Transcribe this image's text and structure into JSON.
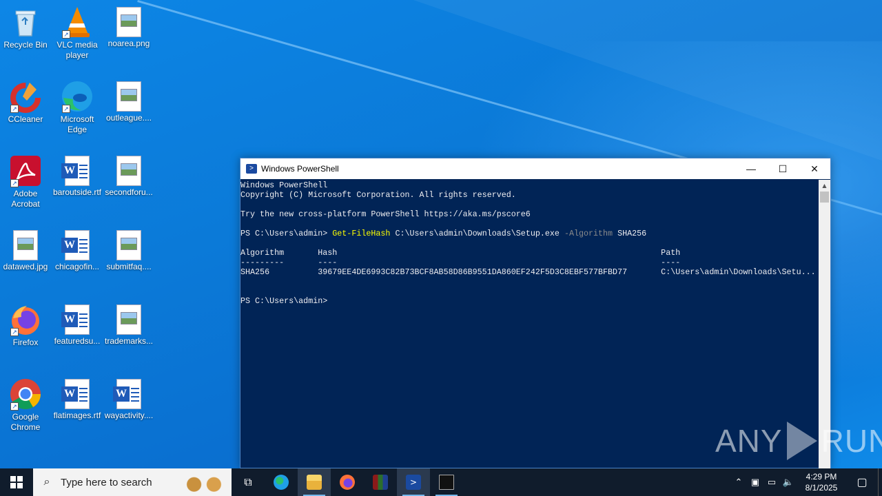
{
  "desktop_icons": [
    {
      "label": "Recycle Bin"
    },
    {
      "label": "VLC media player"
    },
    {
      "label": "noarea.png"
    },
    {
      "label": "CCleaner"
    },
    {
      "label": "Microsoft Edge"
    },
    {
      "label": "outleague...."
    },
    {
      "label": "Adobe Acrobat"
    },
    {
      "label": "baroutside.rtf"
    },
    {
      "label": "secondforu..."
    },
    {
      "label": "datawed.jpg"
    },
    {
      "label": "chicagofin..."
    },
    {
      "label": "submitfaq...."
    },
    {
      "label": "Firefox"
    },
    {
      "label": "featuredsu..."
    },
    {
      "label": "trademarks..."
    },
    {
      "label": "Google Chrome"
    },
    {
      "label": "flatimages.rtf"
    },
    {
      "label": "wayactivity...."
    }
  ],
  "window": {
    "title": "Windows PowerShell",
    "minimize_glyph": "—",
    "maximize_glyph": "☐",
    "close_glyph": "✕"
  },
  "console": {
    "banner1": "Windows PowerShell",
    "banner2": "Copyright (C) Microsoft Corporation. All rights reserved.",
    "banner3": "Try the new cross-platform PowerShell https://aka.ms/pscore6",
    "prompt": "PS C:\\Users\\admin> ",
    "cmd_name": "Get-FileHash",
    "cmd_path": " C:\\Users\\admin\\Downloads\\Setup.exe ",
    "cmd_param": "-Algorithm",
    "cmd_value": " SHA256",
    "header_line": "Algorithm       Hash                                                                   Path",
    "dash_line": "---------       ----                                                                   ----",
    "row_line": "SHA256          39679EE4DE6993C82B73BCF8AB58D86B9551DA860EF242F5D3C8EBF577BFBD77       C:\\Users\\admin\\Downloads\\Setu...",
    "prompt2": "PS C:\\Users\\admin>"
  },
  "watermark": {
    "left": "ANY",
    "right": "RUN"
  },
  "taskbar": {
    "search_placeholder": "Type here to search",
    "time": "4:29 PM",
    "date": "8/1/2025"
  }
}
